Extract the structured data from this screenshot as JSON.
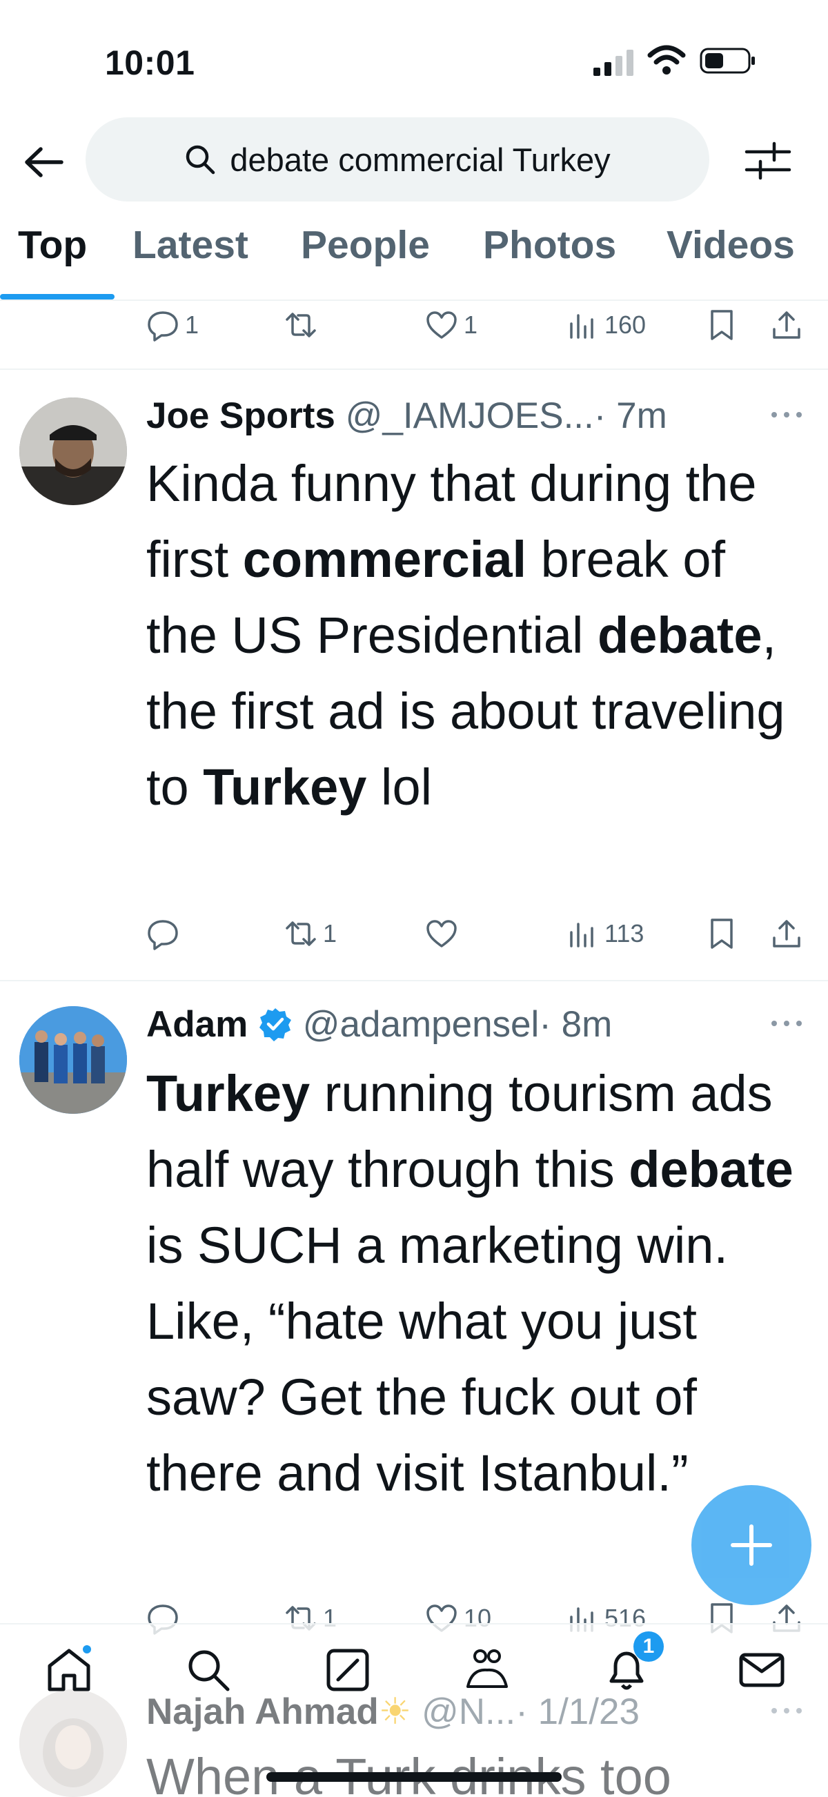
{
  "status_bar": {
    "time": "10:01"
  },
  "search": {
    "query": "debate commercial Turkey"
  },
  "tabs": [
    "Top",
    "Latest",
    "People",
    "Photos",
    "Videos"
  ],
  "top_partial_tweet": {
    "replies": "1",
    "likes": "1",
    "views": "160"
  },
  "tweets": [
    {
      "name": "Joe Sports",
      "handle": "@_IAMJOES...",
      "time": "· 7m",
      "text": {
        "t1": "Kinda funny that during the first ",
        "b1": "commercial",
        "t2": " break of the US Presidential ",
        "b2": "debate",
        "t3": ", the first ad is about traveling to ",
        "b3": "Turkey",
        "t4": " lol"
      },
      "retweets": "1",
      "views": "113"
    },
    {
      "name": "Adam",
      "handle": "@adampensel",
      "time": "· 8m",
      "text": {
        "b1": "Turkey",
        "t1": " running tourism ads half way through this ",
        "b2": "debate",
        "t2": " is SUCH a marketing win. Like, “hate what you just saw? Get the fuck out of there and visit Istanbul.”"
      },
      "retweets": "1",
      "likes": "10",
      "views": "516"
    },
    {
      "name": "Najah Ahmad",
      "handle": "@N...",
      "time": "· 1/1/23",
      "text_partial": "When a Turk drinks too"
    }
  ],
  "nav": {
    "notifications_badge": "1"
  },
  "colors": {
    "accent": "#1d9bf0",
    "text": "#0f1419",
    "muted": "#536471",
    "divider": "#eff3f4"
  }
}
